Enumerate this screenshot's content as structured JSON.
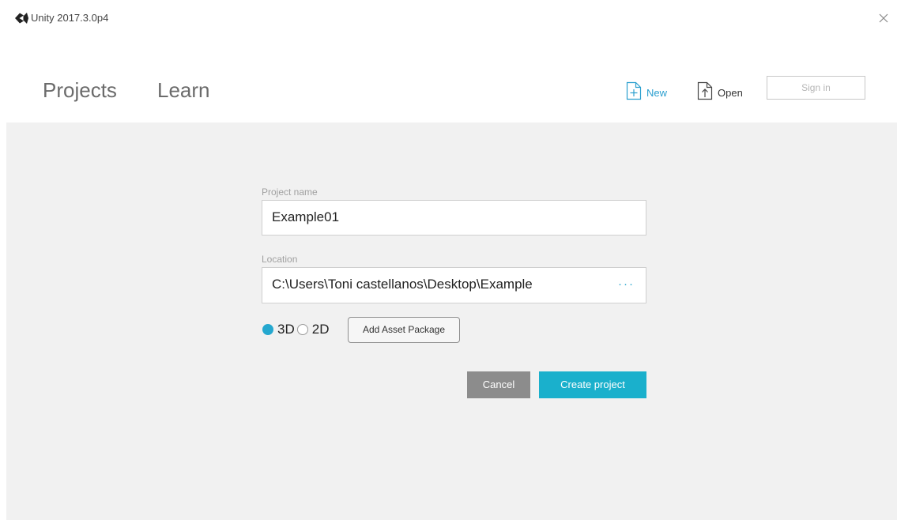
{
  "window": {
    "title": "Unity 2017.3.0p4",
    "logo_icon": "unity-logo-icon",
    "close_icon": "close-icon"
  },
  "nav": {
    "tabs": [
      {
        "label": "Projects"
      },
      {
        "label": "Learn"
      }
    ],
    "actions": {
      "new_label": "New",
      "new_icon": "new-file-icon",
      "open_label": "Open",
      "open_icon": "open-file-icon",
      "signin_label": "Sign in"
    }
  },
  "form": {
    "project_name_label": "Project name",
    "project_name_value": "Example01",
    "location_label": "Location",
    "location_value": "C:\\Users\\Toni castellanos\\Desktop\\Example",
    "browse_label": "···",
    "mode_options": [
      {
        "label": "3D",
        "selected": true
      },
      {
        "label": "2D",
        "selected": false
      }
    ],
    "add_asset_label": "Add Asset Package",
    "cancel_label": "Cancel",
    "create_label": "Create project"
  },
  "colors": {
    "accent": "#1ab0cc",
    "new_link": "#2a9fcf",
    "cancel_bg": "#8c8c8c",
    "content_bg": "#f1f1f1"
  }
}
